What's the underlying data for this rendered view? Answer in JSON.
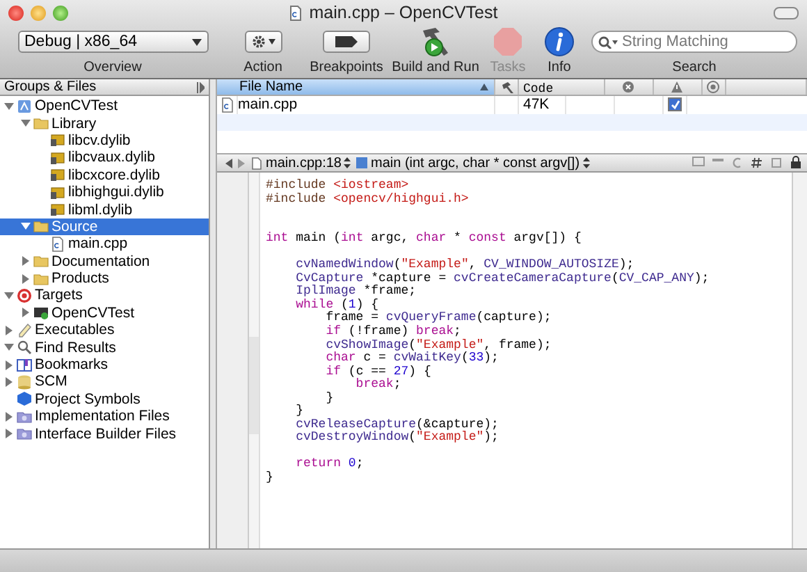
{
  "window": {
    "title": "main.cpp – OpenCVTest"
  },
  "toolbar": {
    "scheme": "Debug | x86_64",
    "search_placeholder": "String Matching",
    "items": [
      {
        "kind": "overview",
        "label": "Overview",
        "disabled": false
      },
      {
        "kind": "action",
        "label": "Action",
        "disabled": false
      },
      {
        "kind": "breakpoints",
        "label": "Breakpoints",
        "disabled": false
      },
      {
        "kind": "build",
        "label": "Build and Run",
        "disabled": false
      },
      {
        "kind": "tasks",
        "label": "Tasks",
        "disabled": true
      },
      {
        "kind": "info",
        "label": "Info",
        "disabled": false
      },
      {
        "kind": "search",
        "label": "Search",
        "disabled": false
      }
    ]
  },
  "sidebar": {
    "header": "Groups & Files",
    "items": [
      {
        "label": "OpenCVTest",
        "kind": "project",
        "expanded": true,
        "selected": false,
        "children": [
          {
            "label": "Library",
            "kind": "folder",
            "expanded": true,
            "selected": false,
            "children": [
              {
                "label": "libcv.dylib",
                "kind": "library",
                "selected": false
              },
              {
                "label": "libcvaux.dylib",
                "kind": "library",
                "selected": false
              },
              {
                "label": "libcxcore.dylib",
                "kind": "library",
                "selected": false
              },
              {
                "label": "libhighgui.dylib",
                "kind": "library",
                "selected": false
              },
              {
                "label": "libml.dylib",
                "kind": "library",
                "selected": false
              }
            ]
          },
          {
            "label": "Source",
            "kind": "folder",
            "expanded": true,
            "selected": true,
            "children": [
              {
                "label": "main.cpp",
                "kind": "cpp",
                "selected": false
              }
            ]
          },
          {
            "label": "Documentation",
            "kind": "folder",
            "expanded": false,
            "selected": false
          },
          {
            "label": "Products",
            "kind": "folder",
            "expanded": false,
            "selected": false
          }
        ]
      },
      {
        "label": "Targets",
        "kind": "target",
        "expanded": true,
        "selected": false,
        "children": [
          {
            "label": "OpenCVTest",
            "kind": "app",
            "expanded": false,
            "selected": false
          }
        ]
      },
      {
        "label": "Executables",
        "kind": "executables",
        "expanded": false,
        "selected": false
      },
      {
        "label": "Find Results",
        "kind": "find",
        "expanded": true,
        "selected": false
      },
      {
        "label": "Bookmarks",
        "kind": "bookmarks",
        "expanded": false,
        "selected": false
      },
      {
        "label": "SCM",
        "kind": "scm",
        "expanded": false,
        "selected": false
      },
      {
        "label": "Project Symbols",
        "kind": "symbols",
        "selected": false
      },
      {
        "label": "Implementation Files",
        "kind": "smartgroup",
        "expanded": false,
        "selected": false
      },
      {
        "label": "Interface Builder Files",
        "kind": "smartgroup",
        "expanded": false,
        "selected": false
      }
    ]
  },
  "file_list": {
    "columns": [
      {
        "kind": "text",
        "label": "File Name"
      },
      {
        "kind": "hammer"
      },
      {
        "kind": "text",
        "label": "Code"
      },
      {
        "kind": "errors"
      },
      {
        "kind": "warnings"
      },
      {
        "kind": "target"
      }
    ],
    "rows": [
      {
        "name": "main.cpp",
        "code": "47K",
        "checked": true
      }
    ]
  },
  "editor": {
    "file": "main.cpp:18",
    "function": "main (int argc, char * const argv[])",
    "lines": [
      {
        "kind": "code",
        "tokens": [
          {
            "kind": "pre",
            "text": "#include "
          },
          {
            "kind": "str",
            "text": "<iostream>"
          }
        ]
      },
      {
        "kind": "code",
        "tokens": [
          {
            "kind": "pre",
            "text": "#include "
          },
          {
            "kind": "str",
            "text": "<opencv/highgui.h>"
          }
        ]
      },
      {
        "kind": "blank"
      },
      {
        "kind": "blank"
      },
      {
        "kind": "code",
        "tokens": [
          {
            "kind": "kw",
            "text": "int"
          },
          {
            "kind": "plain",
            "text": " main ("
          },
          {
            "kind": "kw",
            "text": "int"
          },
          {
            "kind": "plain",
            "text": " argc, "
          },
          {
            "kind": "kw",
            "text": "char"
          },
          {
            "kind": "plain",
            "text": " * "
          },
          {
            "kind": "kw",
            "text": "const"
          },
          {
            "kind": "plain",
            "text": " argv[]) {"
          }
        ]
      },
      {
        "kind": "blank"
      },
      {
        "kind": "code",
        "tokens": [
          {
            "kind": "fn",
            "text": "    cvNamedWindow"
          },
          {
            "kind": "plain",
            "text": "("
          },
          {
            "kind": "str",
            "text": "\"Example\""
          },
          {
            "kind": "plain",
            "text": ", "
          },
          {
            "kind": "fn",
            "text": "CV_WINDOW_AUTOSIZE"
          },
          {
            "kind": "plain",
            "text": ");"
          }
        ]
      },
      {
        "kind": "code",
        "tokens": [
          {
            "kind": "fn",
            "text": "    CvCapture"
          },
          {
            "kind": "plain",
            "text": " *capture = "
          },
          {
            "kind": "fn",
            "text": "cvCreateCameraCapture"
          },
          {
            "kind": "plain",
            "text": "("
          },
          {
            "kind": "fn",
            "text": "CV_CAP_ANY"
          },
          {
            "kind": "plain",
            "text": ");"
          }
        ]
      },
      {
        "kind": "code",
        "tokens": [
          {
            "kind": "fn",
            "text": "    IplImage"
          },
          {
            "kind": "plain",
            "text": " *frame;"
          }
        ]
      },
      {
        "kind": "code",
        "tokens": [
          {
            "kind": "kw",
            "text": "    while"
          },
          {
            "kind": "plain",
            "text": " ("
          },
          {
            "kind": "num",
            "text": "1"
          },
          {
            "kind": "plain",
            "text": ") {"
          }
        ]
      },
      {
        "kind": "code",
        "tokens": [
          {
            "kind": "plain",
            "text": "        frame = "
          },
          {
            "kind": "fn",
            "text": "cvQueryFrame"
          },
          {
            "kind": "plain",
            "text": "(capture);"
          }
        ]
      },
      {
        "kind": "code",
        "tokens": [
          {
            "kind": "kw",
            "text": "        if"
          },
          {
            "kind": "plain",
            "text": " (!frame) "
          },
          {
            "kind": "kw",
            "text": "break"
          },
          {
            "kind": "plain",
            "text": ";"
          }
        ]
      },
      {
        "kind": "code",
        "tokens": [
          {
            "kind": "fn",
            "text": "        cvShowImage"
          },
          {
            "kind": "plain",
            "text": "("
          },
          {
            "kind": "str",
            "text": "\"Example\""
          },
          {
            "kind": "plain",
            "text": ", frame);"
          }
        ]
      },
      {
        "kind": "code",
        "tokens": [
          {
            "kind": "kw",
            "text": "        char"
          },
          {
            "kind": "plain",
            "text": " c = "
          },
          {
            "kind": "fn",
            "text": "cvWaitKey"
          },
          {
            "kind": "plain",
            "text": "("
          },
          {
            "kind": "num",
            "text": "33"
          },
          {
            "kind": "plain",
            "text": ");"
          }
        ]
      },
      {
        "kind": "code",
        "tokens": [
          {
            "kind": "kw",
            "text": "        if"
          },
          {
            "kind": "plain",
            "text": " (c == "
          },
          {
            "kind": "num",
            "text": "27"
          },
          {
            "kind": "plain",
            "text": ") {"
          }
        ]
      },
      {
        "kind": "code",
        "tokens": [
          {
            "kind": "kw",
            "text": "            break"
          },
          {
            "kind": "plain",
            "text": ";"
          }
        ]
      },
      {
        "kind": "code",
        "tokens": [
          {
            "kind": "plain",
            "text": "        }"
          }
        ]
      },
      {
        "kind": "code",
        "tokens": [
          {
            "kind": "plain",
            "text": "    }"
          }
        ]
      },
      {
        "kind": "code",
        "tokens": [
          {
            "kind": "fn",
            "text": "    cvReleaseCapture"
          },
          {
            "kind": "plain",
            "text": "(&capture);"
          }
        ]
      },
      {
        "kind": "code",
        "tokens": [
          {
            "kind": "fn",
            "text": "    cvDestroyWindow"
          },
          {
            "kind": "plain",
            "text": "("
          },
          {
            "kind": "str",
            "text": "\"Example\""
          },
          {
            "kind": "plain",
            "text": ");"
          }
        ]
      },
      {
        "kind": "blank"
      },
      {
        "kind": "code",
        "tokens": [
          {
            "kind": "kw",
            "text": "    return "
          },
          {
            "kind": "num",
            "text": "0"
          },
          {
            "kind": "plain",
            "text": ";"
          }
        ]
      },
      {
        "kind": "code",
        "tokens": [
          {
            "kind": "plain",
            "text": "}"
          }
        ]
      }
    ]
  }
}
